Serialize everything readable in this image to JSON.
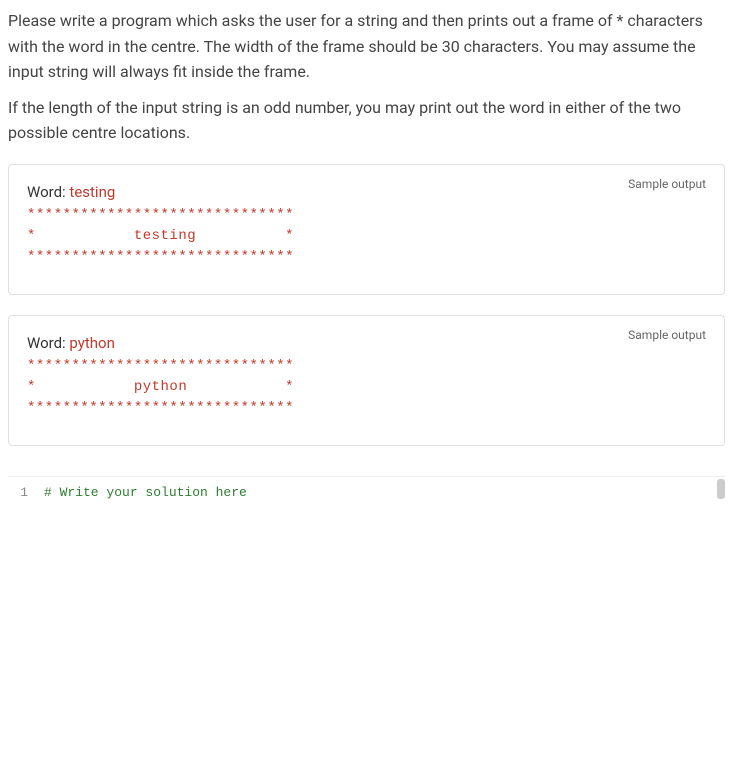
{
  "instructions": {
    "p1": "Please write a program which asks the user for a string and then prints out a frame of * characters with the word in the centre. The width of the frame should be 30 characters. You may assume the input string will always fit inside the frame.",
    "p2": "If the length of the input string is an odd number, you may print out the word in either of the two possible centre locations."
  },
  "samples": [
    {
      "label": "Sample output",
      "word_label": "Word: ",
      "word_value": "testing",
      "lines": [
        "******************************",
        "*           testing          *",
        "******************************"
      ]
    },
    {
      "label": "Sample output",
      "word_label": "Word: ",
      "word_value": "python",
      "lines": [
        "******************************",
        "*           python           *",
        "******************************"
      ]
    }
  ],
  "editor": {
    "line_number": "1",
    "code": "# Write your solution here"
  }
}
